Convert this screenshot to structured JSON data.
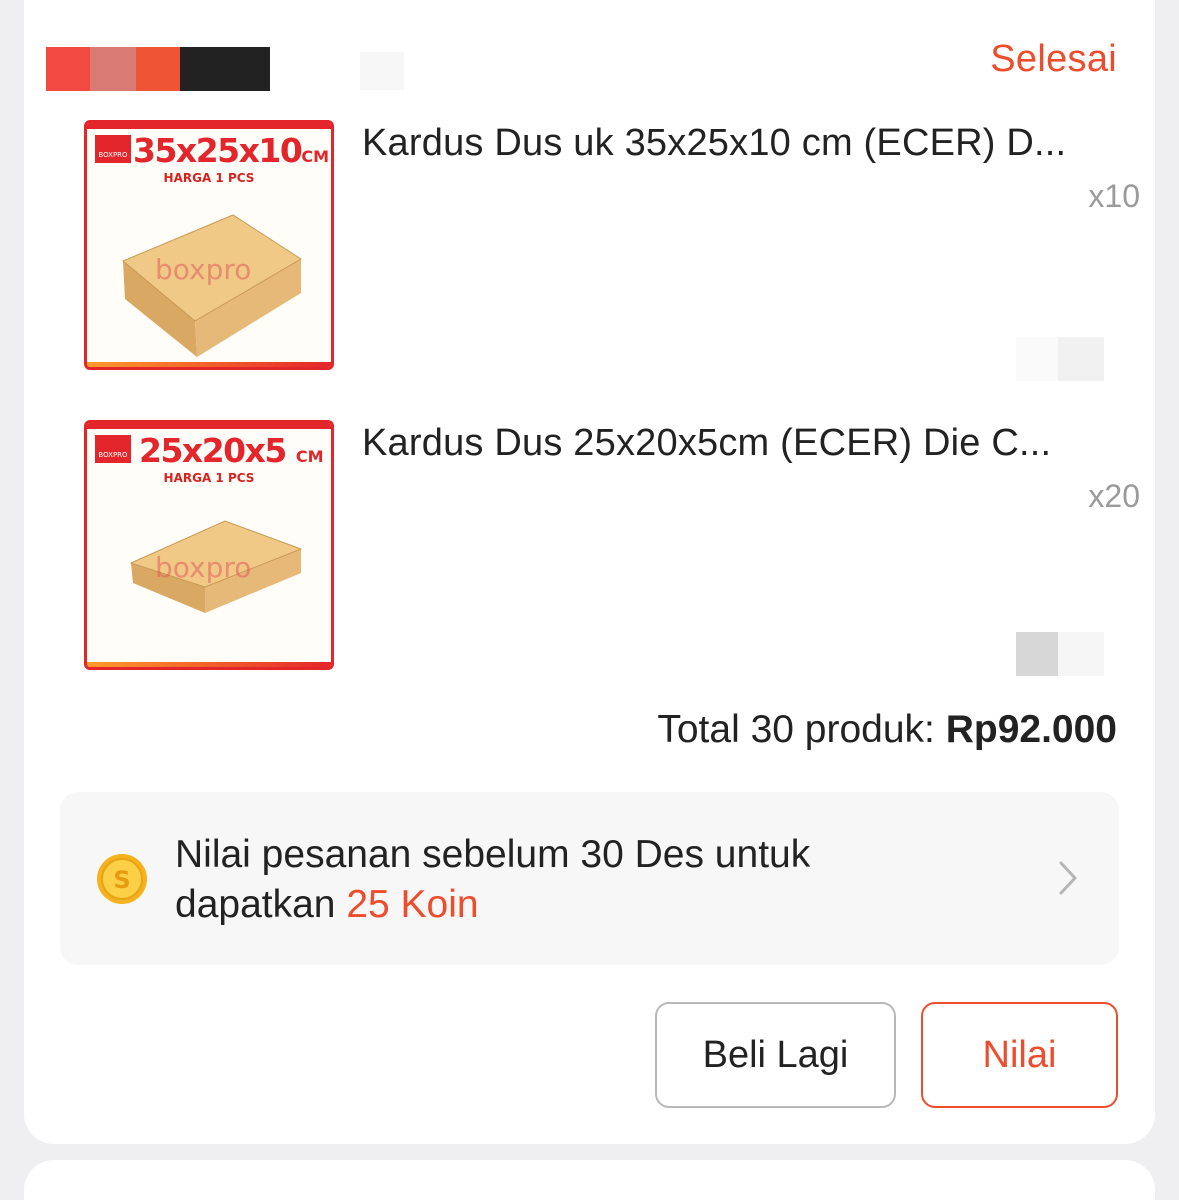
{
  "order": {
    "status": "Selesai",
    "colors": {
      "accent": "#ee4d2d",
      "redaction": [
        "#f24a40",
        "#d97a74",
        "#ef5535",
        "#222222"
      ]
    }
  },
  "products": [
    {
      "title": "Kardus Dus uk 35x25x10 cm (ECER) D...",
      "quantity": "x10",
      "thumbnail": {
        "size_label": "35x25x10",
        "unit_label": "CM",
        "caption": "HARGA 1 PCS",
        "brand": "boxpro",
        "logo_text": "BOXPRO"
      }
    },
    {
      "title": "Kardus Dus 25x20x5cm (ECER) Die C...",
      "quantity": "x20",
      "thumbnail": {
        "size_label": "25x20x5",
        "unit_label": "CM",
        "caption": "HARGA 1 PCS",
        "brand": "boxpro",
        "logo_text": "BOXPRO"
      }
    }
  ],
  "summary": {
    "total_label": "Total 30 produk: ",
    "total_value": "Rp92.000"
  },
  "coin_promo": {
    "text_before": "Nilai pesanan sebelum 30 Des untuk dapatkan ",
    "highlight": "25 Koin",
    "icon": "coin-icon",
    "chevron": "chevron-right-icon"
  },
  "actions": {
    "buy_again_label": "Beli Lagi",
    "rate_label": "Nilai"
  }
}
